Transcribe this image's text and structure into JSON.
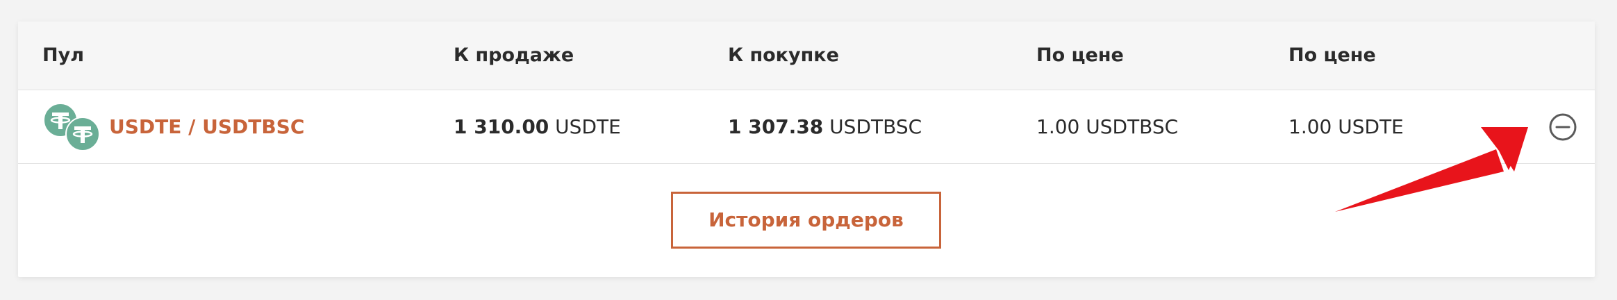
{
  "table": {
    "headers": {
      "pool": "Пул",
      "sell": "К продаже",
      "buy": "К покупке",
      "price_1": "По цене",
      "price_2": "По цене"
    },
    "rows": [
      {
        "pair": "USDTE / USDTBSC",
        "sell_amount": "1 310.00",
        "sell_unit": " USDTE",
        "buy_amount": "1 307.38",
        "buy_unit": " USDTBSC",
        "price_1": "1.00 USDTBSC",
        "price_2": "1.00 USDTE",
        "coin_icons": [
          "tether-icon",
          "tether-icon"
        ]
      }
    ]
  },
  "actions": {
    "history_button": "История ордеров",
    "remove_icon": "minus-circle-icon"
  },
  "colors": {
    "accent": "#c8643a",
    "coin": "#6aae96",
    "annotation_arrow": "#e8141b"
  }
}
